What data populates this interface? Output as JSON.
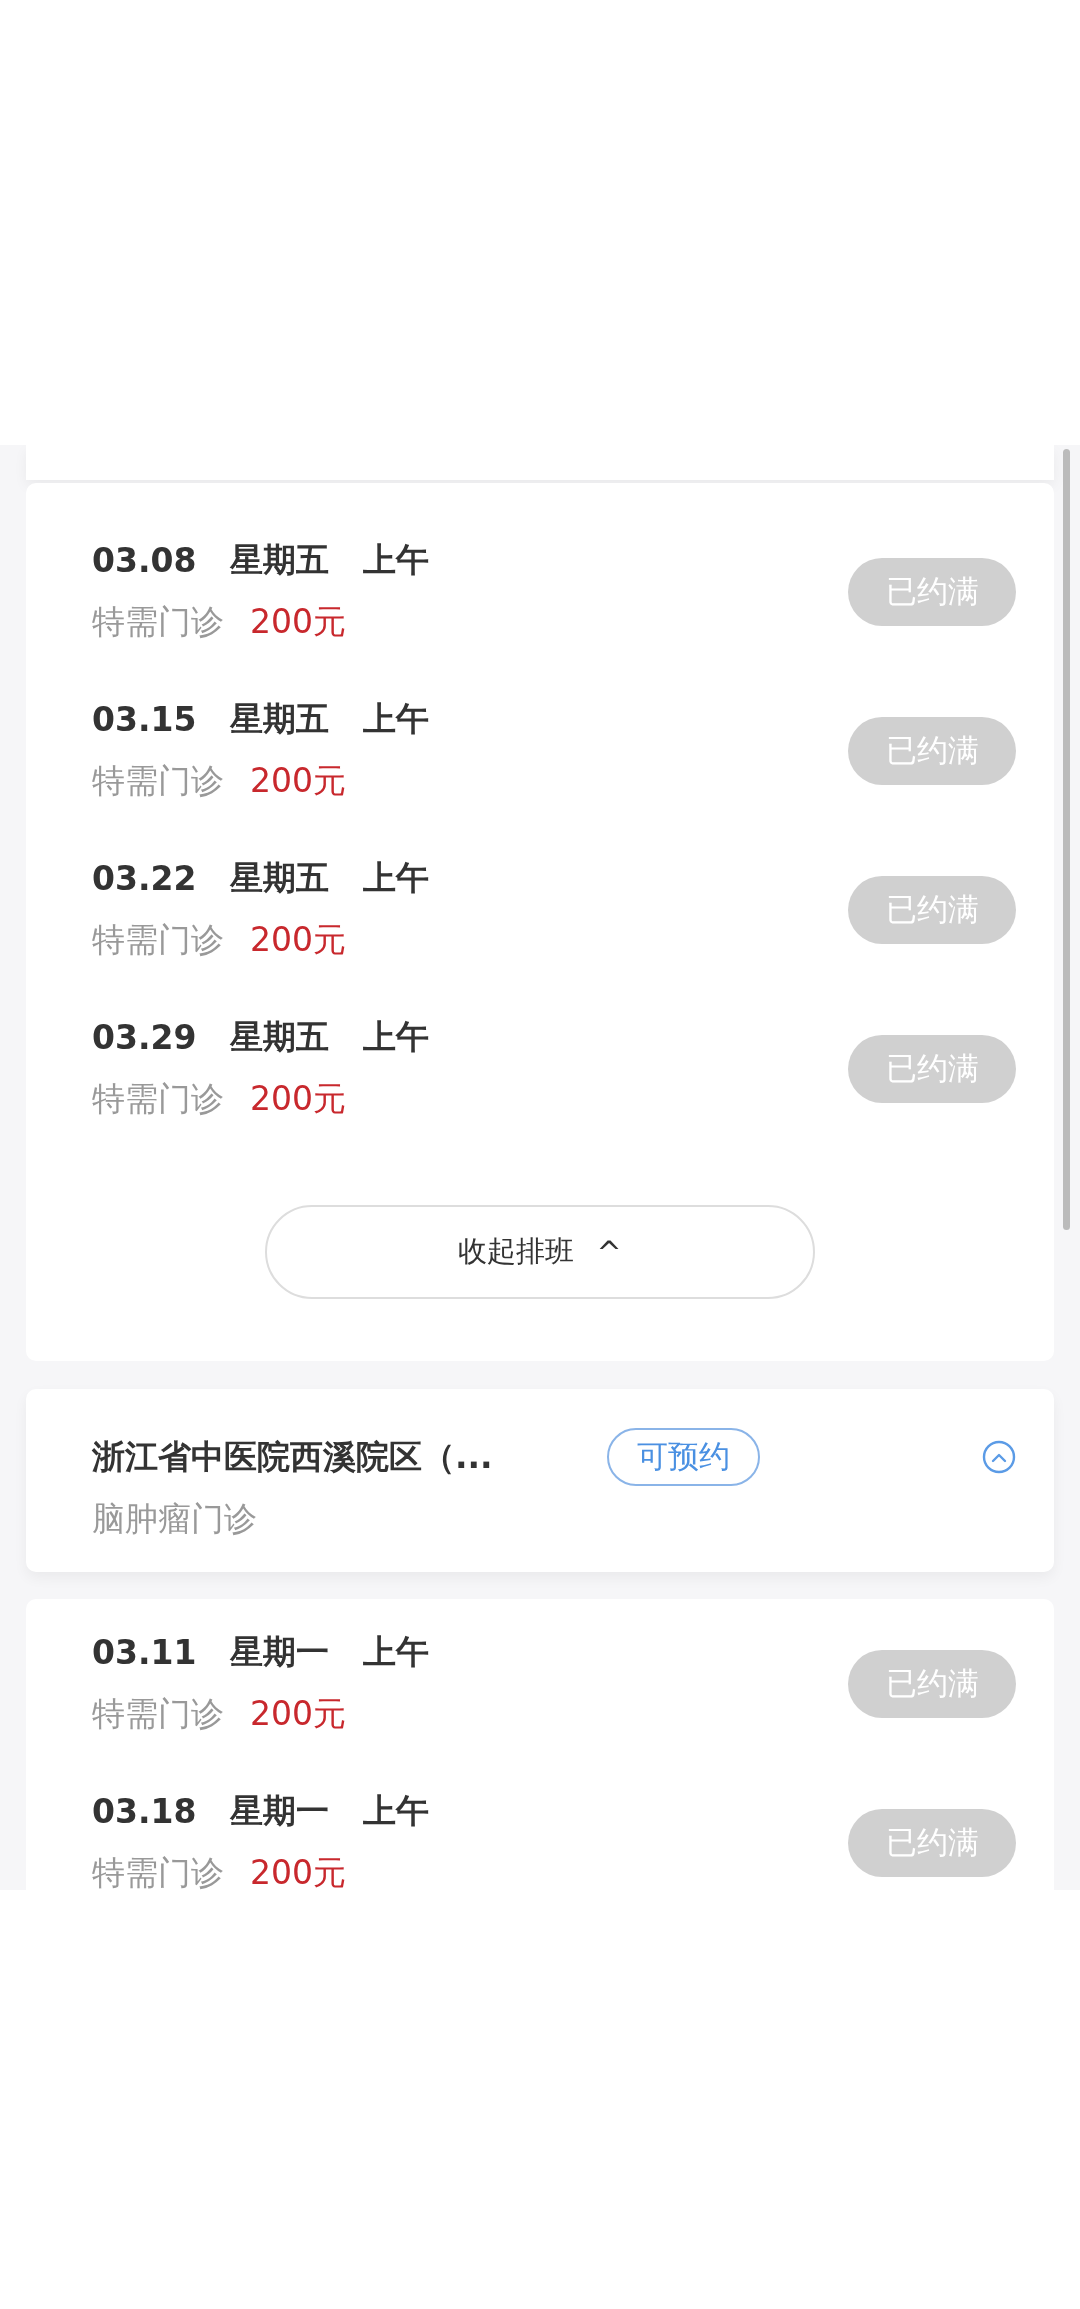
{
  "schedule_groups": [
    {
      "slots": [
        {
          "date": "03.08",
          "weekday": "星期五",
          "period": "上午",
          "type": "特需门诊",
          "price": "200元",
          "status": "已约满",
          "kind": "full"
        },
        {
          "date": "03.15",
          "weekday": "星期五",
          "period": "上午",
          "type": "特需门诊",
          "price": "200元",
          "status": "已约满",
          "kind": "full"
        },
        {
          "date": "03.22",
          "weekday": "星期五",
          "period": "上午",
          "type": "特需门诊",
          "price": "200元",
          "status": "已约满",
          "kind": "full"
        },
        {
          "date": "03.29",
          "weekday": "星期五",
          "period": "上午",
          "type": "特需门诊",
          "price": "200元",
          "status": "已约满",
          "kind": "full"
        }
      ],
      "collapse_button": {
        "label": "收起排班",
        "icon": "^"
      }
    },
    {
      "hospital": {
        "name": "浙江省中医院西溪院区（...",
        "tag": "可预约",
        "department": "脑肿瘤门诊",
        "expanded": true
      },
      "slots": [
        {
          "date": "03.11",
          "weekday": "星期一",
          "period": "上午",
          "type": "特需门诊",
          "price": "200元",
          "status": "已约满",
          "kind": "full"
        },
        {
          "date": "03.18",
          "weekday": "星期一",
          "period": "上午",
          "type": "特需门诊",
          "price": "200元",
          "status": "已约满",
          "kind": "full"
        }
      ]
    }
  ]
}
